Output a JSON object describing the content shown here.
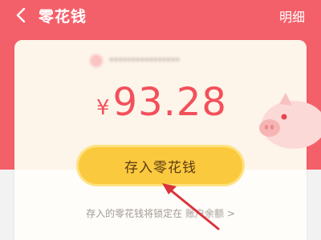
{
  "colors": {
    "header_bg": "#f4606a",
    "amount": "#f2505a",
    "button_bg": "#fbc93e",
    "button_text": "#5b3b12",
    "annotation_arrow": "#d8343b"
  },
  "nav": {
    "back_icon": "chevron-left-icon",
    "title": "零花钱",
    "detail_label": "明细"
  },
  "card": {
    "info_text": "****************",
    "balance": {
      "currency": "¥",
      "amount": "93.28"
    },
    "illustration": "piggy-bank-icon"
  },
  "deposit_button": {
    "label": "存入零花钱"
  },
  "footer": {
    "note_prefix": "存入的零花钱将锁定在",
    "account_label": "账户余额",
    "chevron": ">"
  }
}
